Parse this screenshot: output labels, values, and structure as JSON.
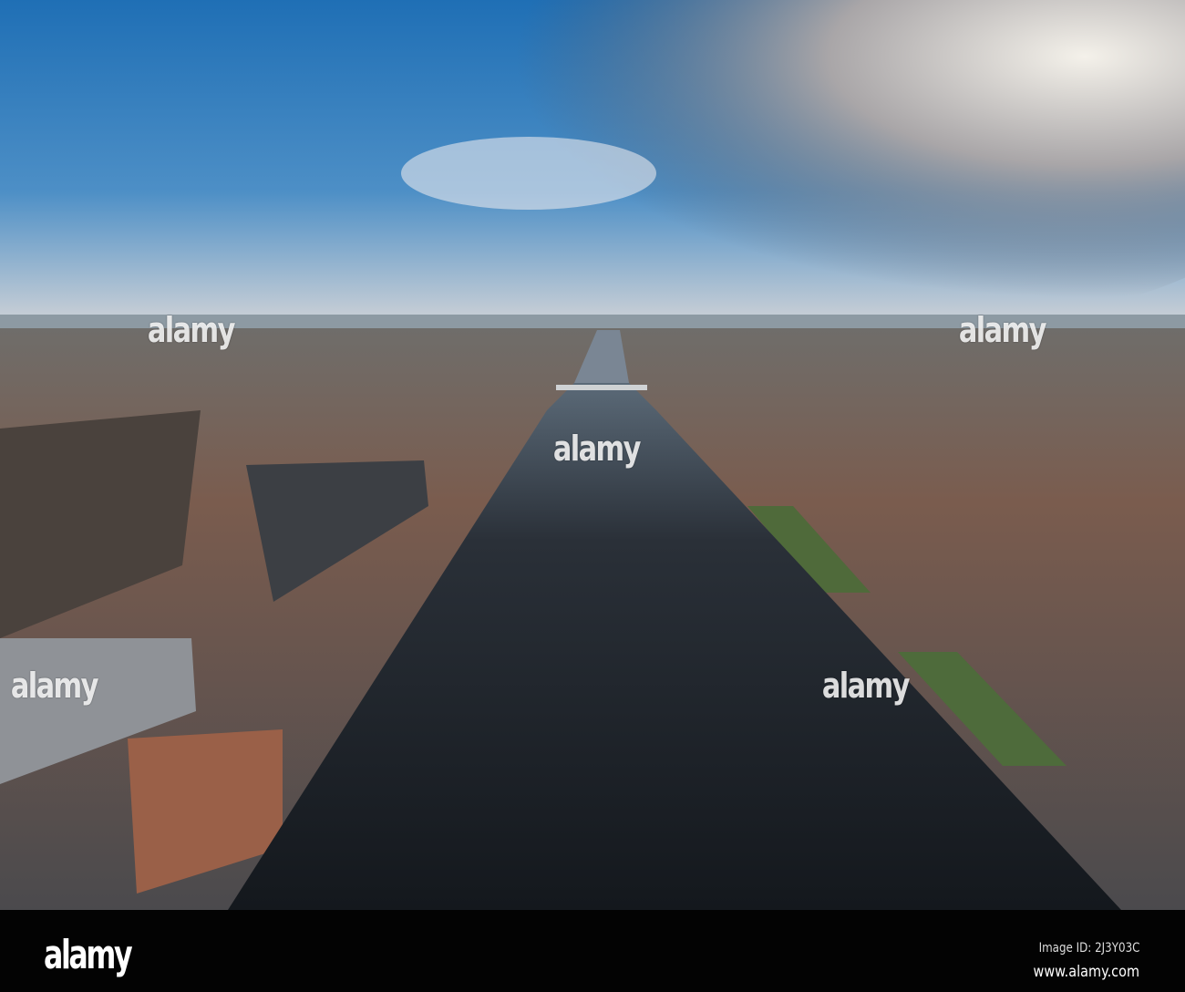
{
  "watermark": {
    "text": "alamy"
  },
  "footer": {
    "logo": "alamy",
    "image_id": "Image ID: 2J3Y03C",
    "website": "www.alamy.com"
  }
}
